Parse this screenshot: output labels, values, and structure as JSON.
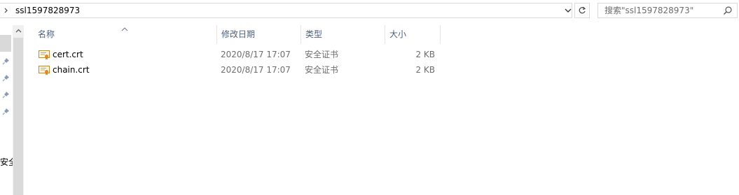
{
  "address": {
    "path": "ssl1597828973",
    "chevron_icon": "chevron-right-icon"
  },
  "search": {
    "placeholder": "搜索\"ssl1597828973\""
  },
  "nav": {
    "partial_label": "安全"
  },
  "columns": {
    "name": "名称",
    "date": "修改日期",
    "type": "类型",
    "size": "大小"
  },
  "files": [
    {
      "name": "cert.crt",
      "date": "2020/8/17 17:07",
      "type": "安全证书",
      "size": "2 KB"
    },
    {
      "name": "chain.crt",
      "date": "2020/8/17 17:07",
      "type": "安全证书",
      "size": "2 KB"
    }
  ],
  "colors": {
    "header_text": "#4c607a",
    "detail_text": "#6d6d6d",
    "border": "#d9d9d9"
  }
}
